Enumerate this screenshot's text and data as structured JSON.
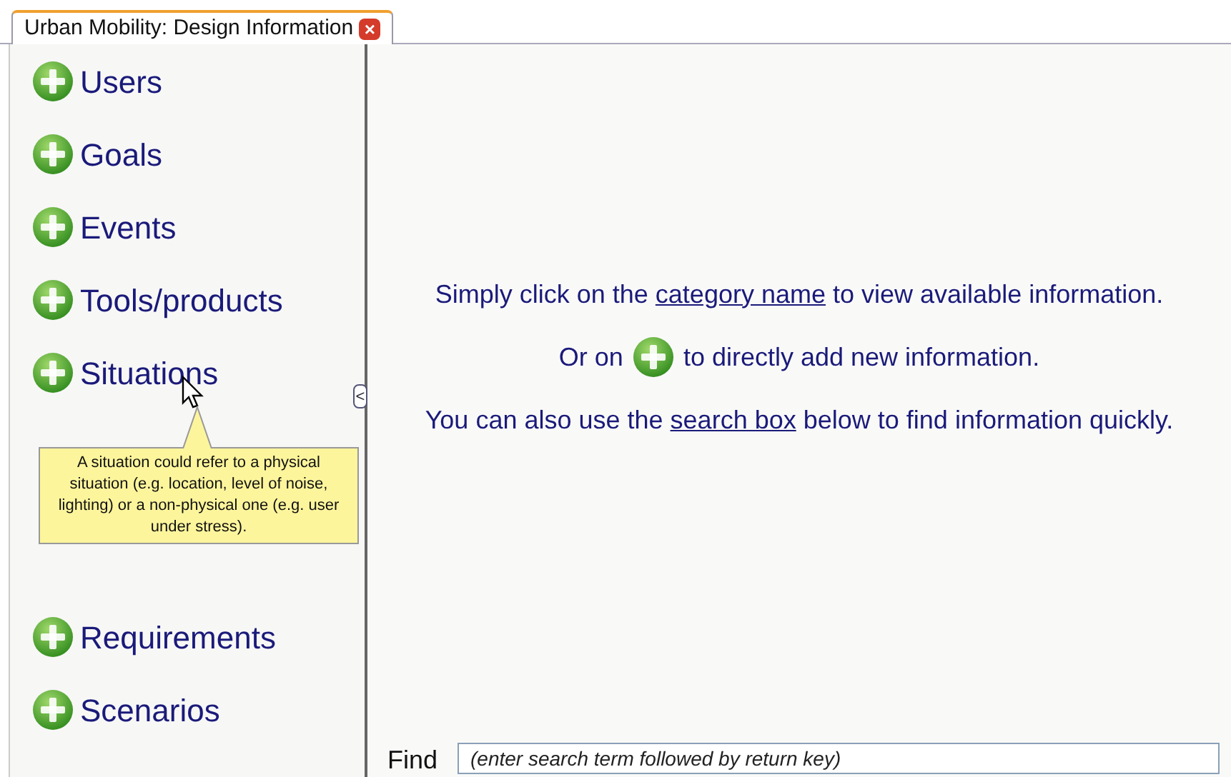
{
  "tab": {
    "title": "Urban Mobility: Design Information",
    "close": "×"
  },
  "categories": [
    {
      "label": "Users"
    },
    {
      "label": "Goals"
    },
    {
      "label": "Events"
    },
    {
      "label": "Tools/products"
    },
    {
      "label": "Situations",
      "tooltip": "A situation could refer to a physical situation (e.g. location, level of noise, lighting) or a non-physical one (e.g. user under stress)."
    },
    {
      "label": "Requirements"
    },
    {
      "label": "Scenarios"
    }
  ],
  "collapse_button": "<",
  "instructions": [
    {
      "kind": "link",
      "before": "Simply click on the",
      "link": "category name",
      "after": "to view available information."
    },
    {
      "kind": "icon",
      "before": "Or on",
      "after": "to directly add new information."
    },
    {
      "kind": "link",
      "before": "You can also use the",
      "link": "search box",
      "after": "below to find information quickly."
    }
  ],
  "find": {
    "label": "Find",
    "placeholder": "(enter search term followed by return key)"
  }
}
